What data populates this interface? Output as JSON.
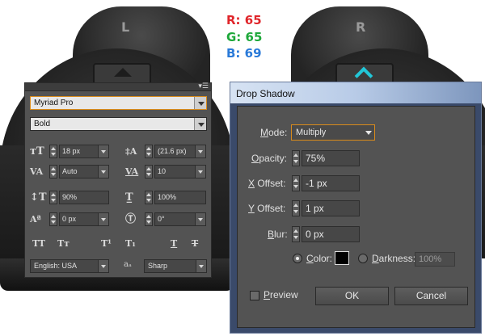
{
  "background": {
    "left_label": "L",
    "right_label": "R",
    "rgb": {
      "r": "R: 65",
      "g": "G: 65",
      "b": "B: 69"
    }
  },
  "character_panel": {
    "menu_icon": "panel-menu-icon",
    "font_family": "Myriad Pro",
    "font_style": "Bold",
    "font_size": "18 px",
    "leading": "(21.6 px)",
    "kerning": "Auto",
    "tracking": "10",
    "vertical_scale": "90%",
    "horizontal_scale": "100%",
    "baseline_shift": "0 px",
    "rotation": "0°",
    "language": "English: USA",
    "antialias_icon_text": "aₐ",
    "antialias": "Sharp"
  },
  "dialog": {
    "title": "Drop Shadow",
    "mode_label_u": "M",
    "mode_label_rest": "ode:",
    "mode_value": "Multiply",
    "opacity_label_u": "O",
    "opacity_label_rest": "pacity:",
    "opacity_value": "75%",
    "x_offset_label_u": "X",
    "x_offset_label_rest": " Offset:",
    "x_offset_value": "-1 px",
    "y_offset_label_u": "Y",
    "y_offset_label_rest": " Offset:",
    "y_offset_value": "1 px",
    "blur_label_u": "B",
    "blur_label_rest": "lur:",
    "blur_value": "0 px",
    "color_label_u": "C",
    "color_label_rest": "olor:",
    "color_swatch": "#000000",
    "darkness_label_u": "D",
    "darkness_label_rest": "arkness:",
    "darkness_value": "100%",
    "preview_label_u": "P",
    "preview_label_rest": "review",
    "ok_label": "OK",
    "cancel_label": "Cancel"
  }
}
